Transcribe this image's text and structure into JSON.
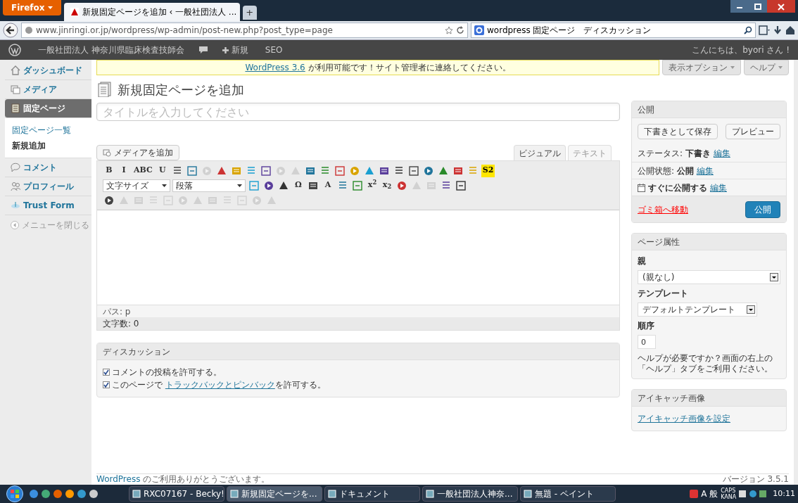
{
  "browser": {
    "menu_button": "Firefox",
    "tabs": [
      {
        "title": "新規固定ページを追加 ‹ 一般社団法人 ...",
        "selected": true
      }
    ],
    "new_tab": "+",
    "url": "www.jinringi.or.jp/wordpress/wp-admin/post-new.php?post_type=page",
    "search": "wordpress 固定ページ　ディスカッション"
  },
  "admin_bar": {
    "site": "一般社団法人 神奈川県臨床検査技師会",
    "new": "新規",
    "seo": "SEO",
    "greeting": "こんにちは、byori さん !"
  },
  "sidebar": {
    "items": [
      {
        "label": "ダッシュボード",
        "selected": false
      },
      {
        "label": "メディア",
        "selected": false
      },
      {
        "label": "固定ページ",
        "selected": true,
        "children": [
          {
            "label": "固定ページ一覧",
            "selected": false
          },
          {
            "label": "新規追加",
            "selected": true
          }
        ]
      },
      {
        "label": "コメント",
        "selected": false
      },
      {
        "label": "プロフィール",
        "selected": false
      },
      {
        "label": "Trust Form",
        "selected": false
      }
    ],
    "collapse": "メニューを閉じる"
  },
  "notice": {
    "link": "WordPress 3.6",
    "rest": " が利用可能です！サイト管理者に連絡してください。"
  },
  "screen_options": "表示オプション",
  "help": "ヘルプ",
  "page_title": "新規固定ページを追加",
  "title_field": {
    "placeholder": "タイトルを入力してください"
  },
  "add_media": "メディアを追加",
  "editor_tabs": [
    {
      "label": "ビジュアル",
      "selected": true
    },
    {
      "label": "テキスト",
      "selected": false
    }
  ],
  "toolbar_rows": [
    [
      {
        "kind": "text",
        "label": "B",
        "disabled": false
      },
      {
        "kind": "text",
        "label": "I",
        "disabled": false
      },
      {
        "kind": "text",
        "label": "ABC",
        "disabled": false
      },
      {
        "kind": "text",
        "label": "U",
        "disabled": false
      },
      {
        "kind": "icon",
        "disabled": false
      },
      {
        "kind": "icon",
        "disabled": false
      },
      {
        "kind": "icon",
        "disabled": true
      },
      {
        "kind": "icon",
        "disabled": false
      },
      {
        "kind": "icon",
        "disabled": false
      },
      {
        "kind": "icon",
        "disabled": false
      },
      {
        "kind": "icon",
        "disabled": false
      },
      {
        "kind": "icon",
        "disabled": true
      },
      {
        "kind": "icon",
        "disabled": true
      },
      {
        "kind": "icon",
        "disabled": false
      },
      {
        "kind": "icon",
        "disabled": false
      },
      {
        "kind": "icon",
        "disabled": false
      },
      {
        "kind": "icon",
        "disabled": false
      },
      {
        "kind": "icon",
        "disabled": false
      },
      {
        "kind": "icon",
        "disabled": false
      },
      {
        "kind": "icon",
        "disabled": false
      },
      {
        "kind": "icon",
        "disabled": false
      },
      {
        "kind": "icon",
        "disabled": false
      },
      {
        "kind": "icon",
        "disabled": false
      },
      {
        "kind": "icon",
        "disabled": false
      },
      {
        "kind": "icon",
        "disabled": false
      },
      {
        "kind": "text",
        "label": "S2",
        "disabled": false
      }
    ],
    [
      {
        "kind": "select",
        "label": "文字サイズ",
        "disabled": false
      },
      {
        "kind": "select",
        "label": "段落",
        "disabled": false
      },
      {
        "kind": "icon",
        "disabled": false
      },
      {
        "kind": "icon",
        "disabled": false
      },
      {
        "kind": "icon",
        "disabled": false
      },
      {
        "kind": "text",
        "label": "Ω",
        "disabled": false
      },
      {
        "kind": "icon",
        "disabled": false
      },
      {
        "kind": "text",
        "label": "A",
        "disabled": false
      },
      {
        "kind": "icon",
        "disabled": false
      },
      {
        "kind": "icon",
        "disabled": false
      },
      {
        "kind": "text",
        "label": "x$^{2}$",
        "disabled": false
      },
      {
        "kind": "text",
        "label": "x$_{2}$",
        "disabled": false
      },
      {
        "kind": "icon",
        "disabled": false
      },
      {
        "kind": "icon",
        "disabled": true
      },
      {
        "kind": "icon",
        "disabled": true
      },
      {
        "kind": "icon",
        "disabled": false
      },
      {
        "kind": "icon",
        "disabled": false
      }
    ],
    [
      {
        "kind": "icon",
        "disabled": false
      },
      {
        "kind": "icon",
        "disabled": true
      },
      {
        "kind": "icon",
        "disabled": true
      },
      {
        "kind": "icon",
        "disabled": true
      },
      {
        "kind": "icon",
        "disabled": true
      },
      {
        "kind": "icon",
        "disabled": true
      },
      {
        "kind": "icon",
        "disabled": true
      },
      {
        "kind": "icon",
        "disabled": true
      },
      {
        "kind": "icon",
        "disabled": true
      },
      {
        "kind": "icon",
        "disabled": true
      },
      {
        "kind": "icon",
        "disabled": true
      },
      {
        "kind": "icon",
        "disabled": true
      }
    ]
  ],
  "path": "パス: p",
  "word_count": "文字数: 0",
  "discussion": {
    "title": "ディスカッション",
    "options": [
      {
        "before": "コメントの投稿を許可する。",
        "checked": true
      },
      {
        "before": "このページで ",
        "link": "トラックバックとピンバック",
        "after": "を許可する。",
        "checked": true
      }
    ]
  },
  "publish": {
    "title": "公開",
    "save_draft": "下書きとして保存",
    "preview": "プレビュー",
    "rows": [
      {
        "kind": "status",
        "label": "ステータス:",
        "value": "下書き",
        "edit": "編集"
      },
      {
        "kind": "status",
        "label": "公開状態:",
        "value": "公開",
        "edit": "編集"
      },
      {
        "kind": "schedule",
        "value": "すぐに公開する",
        "edit": "編集"
      }
    ],
    "trash": "ゴミ箱へ移動",
    "publish_button": "公開"
  },
  "page_attributes": {
    "title": "ページ属性",
    "parent_label": "親",
    "parent": "(親なし)",
    "template_label": "テンプレート",
    "template": "デフォルトテンプレート",
    "order_label": "順序",
    "order": "0",
    "help": "ヘルプが必要ですか？画面の右上の「ヘルプ」タブをご利用ください。"
  },
  "featured_image": {
    "title": "アイキャッチ画像",
    "link": "アイキャッチ画像を設定"
  },
  "footer": {
    "thanks_link": "WordPress",
    "thanks": " のご利用ありがとうございます。",
    "version": "バージョン 3.5.1"
  },
  "taskbar": {
    "windows": [
      {
        "label": "RXC07167 - Becky!",
        "selected": false
      },
      {
        "label": "新規固定ページを...",
        "selected": true
      },
      {
        "label": "ドキュメント",
        "selected": false
      },
      {
        "label": "一般社団法人神奈...",
        "selected": false
      },
      {
        "label": "無題 - ペイント",
        "selected": false
      }
    ],
    "ime": "A 般",
    "caps": "CAPS",
    "kana": "KANA",
    "clock": "10:11"
  }
}
